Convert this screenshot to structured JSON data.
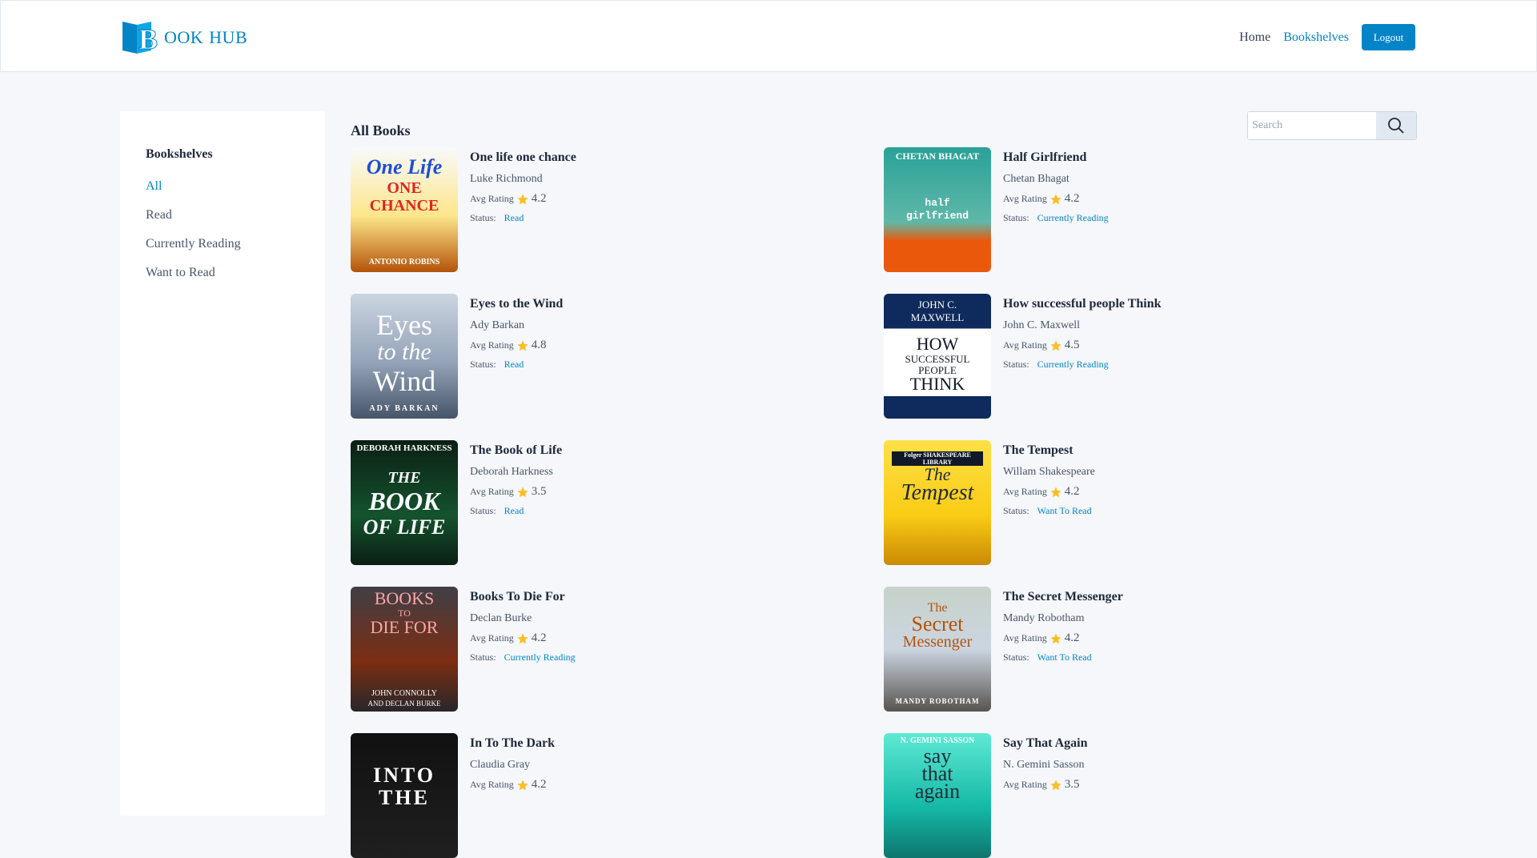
{
  "app": {
    "logo_letter": "B",
    "logo_rest": "OOK",
    "logo_second": "HUB"
  },
  "nav": {
    "home": "Home",
    "bookshelves": "Bookshelves",
    "logout": "Logout"
  },
  "sidebar": {
    "title": "Bookshelves",
    "items": [
      {
        "label": "All",
        "active": true
      },
      {
        "label": "Read",
        "active": false
      },
      {
        "label": "Currently Reading",
        "active": false
      },
      {
        "label": "Want to Read",
        "active": false
      }
    ]
  },
  "main": {
    "section_title": "All Books",
    "search_placeholder": "Search"
  },
  "labels": {
    "avg_rating": "Avg Rating",
    "status": "Status:"
  },
  "colors": {
    "accent": "#0284c7",
    "star": "#fbbf24"
  },
  "books": [
    {
      "title": "One life one chance",
      "author": "Luke Richmond",
      "rating": "4.2",
      "status": "Read",
      "cover": {
        "lines": [
          "One Life",
          "ONE",
          "CHANCE",
          "ANTONIO ROBINS"
        ]
      }
    },
    {
      "title": "Half Girlfriend",
      "author": "Chetan Bhagat",
      "rating": "4.2",
      "status": "Currently Reading",
      "cover": {
        "lines": [
          "CHETAN BHAGAT",
          "half",
          "girlfriend"
        ]
      }
    },
    {
      "title": "Eyes to the Wind",
      "author": "Ady Barkan",
      "rating": "4.8",
      "status": "Read",
      "cover": {
        "lines": [
          "Eyes",
          "to the",
          "Wind",
          "ADY BARKAN"
        ]
      }
    },
    {
      "title": "How successful people Think",
      "author": "John C. Maxwell",
      "rating": "4.5",
      "status": "Currently Reading",
      "cover": {
        "lines": [
          "JOHN C.",
          "MAXWELL",
          "HOW",
          "SUCCESSFUL",
          "PEOPLE",
          "THINK"
        ]
      }
    },
    {
      "title": "The Book of Life",
      "author": "Deborah Harkness",
      "rating": "3.5",
      "status": "Read",
      "cover": {
        "lines": [
          "DEBORAH HARKNESS",
          "THE",
          "BOOK",
          "OF LIFE"
        ]
      }
    },
    {
      "title": "The Tempest",
      "author": "Willam Shakespeare",
      "rating": "4.2",
      "status": "Want To Read",
      "cover": {
        "lines": [
          "Folger SHAKESPEARE LIBRARY",
          "The",
          "Tempest"
        ]
      }
    },
    {
      "title": "Books To Die For",
      "author": "Declan Burke",
      "rating": "4.2",
      "status": "Currently Reading",
      "cover": {
        "lines": [
          "BOOKS",
          "TO",
          "DIE FOR",
          "JOHN CONNOLLY",
          "AND DECLAN BURKE"
        ]
      }
    },
    {
      "title": "The Secret Messenger",
      "author": "Mandy Robotham",
      "rating": "4.2",
      "status": "Want To Read",
      "cover": {
        "lines": [
          "The",
          "Secret",
          "Messenger",
          "MANDY ROBOTHAM"
        ]
      }
    },
    {
      "title": "In To The Dark",
      "author": "Claudia Gray",
      "rating": "4.2",
      "status": "",
      "cover": {
        "lines": [
          "INTO",
          "THE"
        ]
      }
    },
    {
      "title": "Say That Again",
      "author": "N. Gemini Sasson",
      "rating": "3.5",
      "status": "",
      "cover": {
        "lines": [
          "N. GEMINI SASSON",
          "say",
          "that",
          "again"
        ]
      }
    }
  ]
}
